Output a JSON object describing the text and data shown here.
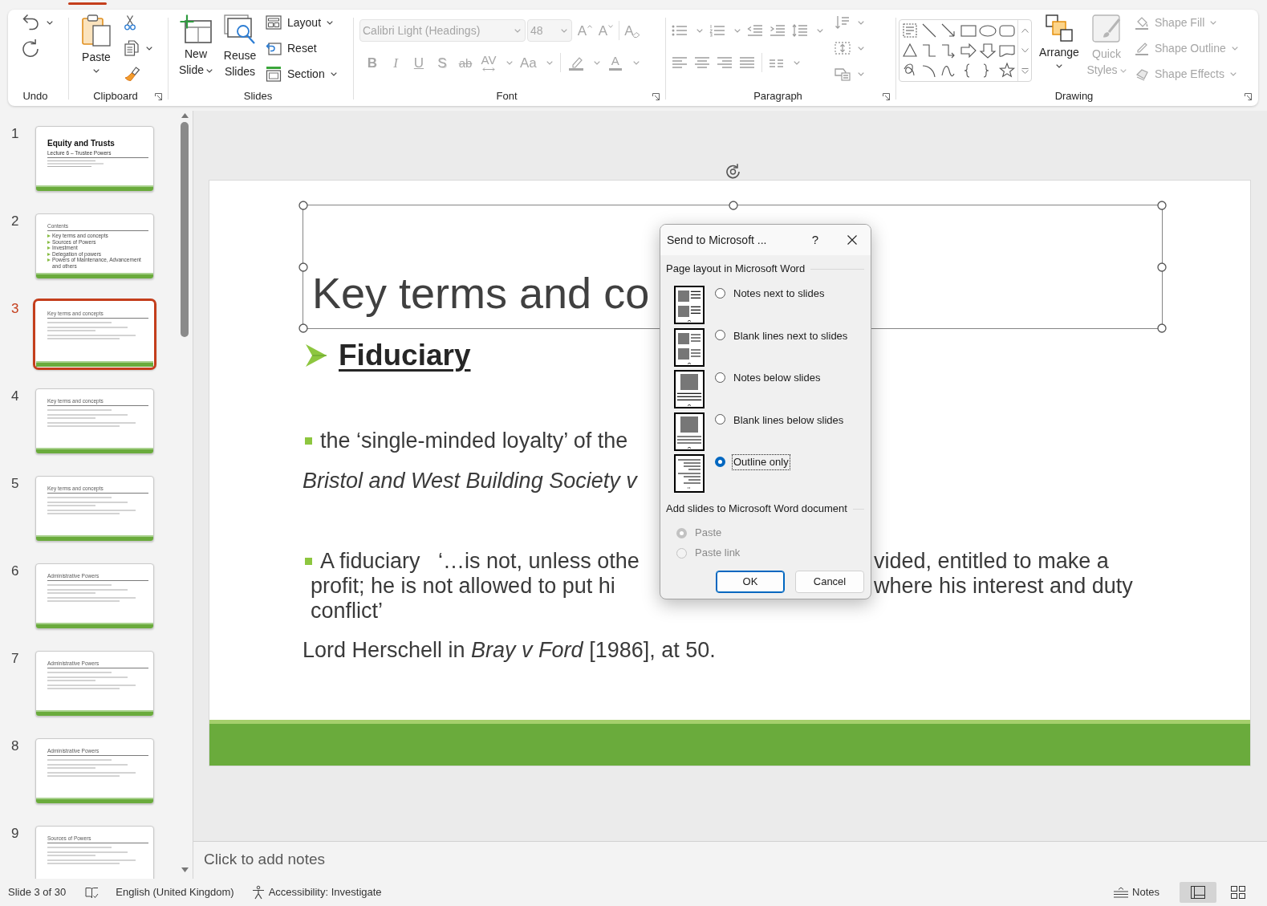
{
  "ribbon": {
    "undo": {
      "label": "Undo"
    },
    "clipboard": {
      "label": "Clipboard",
      "paste": "Paste"
    },
    "slides": {
      "label": "Slides",
      "new_slide": "New Slide",
      "reuse_slides": "Reuse Slides",
      "layout": "Layout",
      "reset": "Reset",
      "section": "Section"
    },
    "font": {
      "label": "Font",
      "disabled": true,
      "font_name": "Calibri Light (Headings)",
      "font_size": "48",
      "size_commands": [
        {
          "kind": "grow",
          "glyph": "A"
        },
        {
          "kind": "shrink",
          "glyph": "A"
        },
        {
          "kind": "clear",
          "glyph": "A"
        }
      ],
      "format_commands": [
        {
          "kind": "bold",
          "glyph": "B"
        },
        {
          "kind": "italic",
          "glyph": "I"
        },
        {
          "kind": "underline",
          "glyph": "U"
        },
        {
          "kind": "shadow",
          "glyph": "S"
        },
        {
          "kind": "strike",
          "glyph": "ab"
        },
        {
          "kind": "spacing",
          "glyph": "AV"
        },
        {
          "kind": "case",
          "glyph": "Aa"
        },
        {
          "kind": "highlight"
        },
        {
          "kind": "color",
          "glyph": "A"
        }
      ]
    },
    "paragraph": {
      "label": "Paragraph",
      "disabled": true
    },
    "drawing": {
      "label": "Drawing",
      "arrange": "Arrange",
      "quick_styles": {
        "label": "Quick Styles",
        "disabled": true
      },
      "shape_commands": [
        {
          "kind": "fill",
          "label": "Shape Fill",
          "disabled": true
        },
        {
          "kind": "outline",
          "label": "Shape Outline",
          "disabled": true
        },
        {
          "kind": "effects",
          "label": "Shape Effects",
          "disabled": true
        }
      ]
    }
  },
  "thumbnails": [
    {
      "number": "1",
      "kind": "title",
      "title": "Equity and Trusts",
      "subtitle": "Lecture 6 – Trustee Powers",
      "selected": false
    },
    {
      "number": "2",
      "kind": "list",
      "title": "Contents",
      "items": [
        "Key terms and concepts",
        "Sources of Powers",
        "Investment",
        "Delegation of powers",
        "Powers of Maintenance, Advancement and others"
      ],
      "selected": false
    },
    {
      "number": "3",
      "kind": "content",
      "title": "Key terms and concepts",
      "selected": true
    },
    {
      "number": "4",
      "kind": "content",
      "title": "Key terms and concepts",
      "selected": false
    },
    {
      "number": "5",
      "kind": "content",
      "title": "Key terms and concepts",
      "selected": false
    },
    {
      "number": "6",
      "kind": "content",
      "title": "Administrative Powers",
      "selected": false
    },
    {
      "number": "7",
      "kind": "content",
      "title": "Administrative Powers",
      "selected": false
    },
    {
      "number": "8",
      "kind": "content",
      "title": "Administrative Powers",
      "selected": false
    },
    {
      "number": "9",
      "kind": "content",
      "title": "Sources of Powers",
      "selected": false
    }
  ],
  "slide": {
    "title": "Key terms and co",
    "heading": "Fiduciary",
    "lines": [
      {
        "kind": "square-bullet",
        "left": "the ‘single-minded loyalty’ of the"
      },
      {
        "kind": "citation",
        "left": "Bristol and West Building Society v"
      },
      {
        "kind": "square-bullet",
        "left": "A fiduciary   ‘…is not, unless othe",
        "right": "vided, entitled to make a"
      },
      {
        "kind": "continuation",
        "left": "profit; he is not allowed to put hi",
        "right": "where his interest and duty"
      },
      {
        "kind": "continuation",
        "left": "conflict’"
      },
      {
        "kind": "source",
        "left": "Lord Herschell in *Bray v Ford* [1986], at 50."
      }
    ]
  },
  "notes": {
    "placeholder": "Click to add notes"
  },
  "dialog": {
    "title": "Send to Microsoft ...",
    "help": "?",
    "sections": [
      {
        "heading": "Page layout in Microsoft Word",
        "options": [
          {
            "kind": "notes-next",
            "label": "Notes next to slides",
            "selected": false,
            "focused": false,
            "disabled": false
          },
          {
            "kind": "blank-next",
            "label": "Blank lines next to slides",
            "selected": false,
            "focused": false,
            "disabled": false
          },
          {
            "kind": "notes-below",
            "label": "Notes below slides",
            "selected": false,
            "focused": false,
            "disabled": false
          },
          {
            "kind": "blank-below",
            "label": "Blank lines below slides",
            "selected": false,
            "focused": false,
            "disabled": false
          },
          {
            "kind": "outline",
            "label": "Outline only",
            "selected": true,
            "focused": true,
            "disabled": false
          }
        ]
      },
      {
        "heading": "Add slides to Microsoft Word document",
        "options": [
          {
            "label": "Paste",
            "selected": true,
            "focused": false,
            "disabled": true
          },
          {
            "label": "Paste link",
            "selected": false,
            "focused": false,
            "disabled": true
          }
        ]
      }
    ],
    "buttons": [
      {
        "label": "OK",
        "default": true
      },
      {
        "label": "Cancel",
        "default": false
      }
    ]
  },
  "status_bar": {
    "slide_info": "Slide 3 of 30",
    "language": "English (United Kingdom)",
    "accessibility": "Accessibility: Investigate",
    "notes": "Notes",
    "views": [
      {
        "kind": "normal",
        "selected": true
      },
      {
        "kind": "sorter",
        "selected": false
      }
    ]
  }
}
